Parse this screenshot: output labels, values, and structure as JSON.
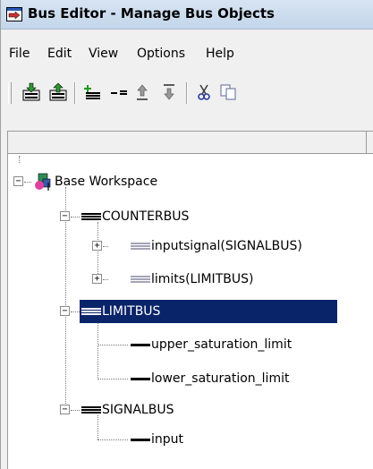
{
  "window": {
    "title": "Bus Editor - Manage Bus Objects"
  },
  "menu": {
    "items": [
      "File",
      "Edit",
      "View",
      "Options",
      "Help"
    ]
  },
  "toolbar": {
    "buttons": [
      "import-icon",
      "export-icon",
      "add-bus-icon",
      "add-element-icon",
      "move-up-icon",
      "move-down-icon",
      "cut-icon",
      "copy-icon"
    ]
  },
  "tree": {
    "root": {
      "label": "Base Workspace",
      "icon": "workspace-icon"
    },
    "counterbus": {
      "label": "COUNTERBUS",
      "children": [
        "inputsignal(SIGNALBUS)",
        "limits(LIMITBUS)"
      ]
    },
    "limitbus": {
      "label": "LIMITBUS",
      "selected": true,
      "children": [
        "upper_saturation_limit",
        "lower_saturation_limit"
      ]
    },
    "signalbus": {
      "label": "SIGNALBUS",
      "children": [
        "input"
      ]
    }
  },
  "colors": {
    "selection": "#0a246a",
    "title_bar": "#c3d6eb"
  }
}
